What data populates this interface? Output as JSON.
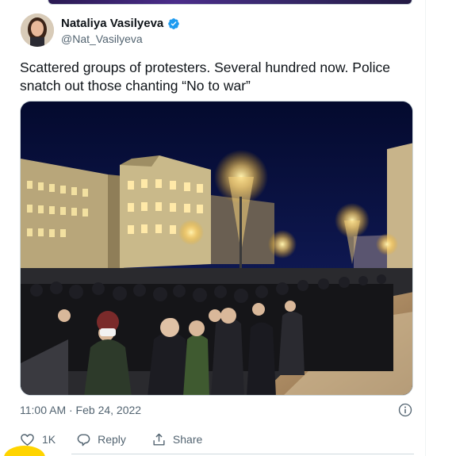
{
  "tweet": {
    "author_name": "Nataliya Vasilyeva",
    "handle": "@Nat_Vasilyeva",
    "verified_icon": "verified-badge-icon",
    "text": "Scattered groups of protesters. Several hundred now. Police snatch out those chanting “No to war”",
    "timestamp": "11:00 AM · Feb 24, 2022",
    "media": {
      "icon": "photo-image"
    }
  },
  "actions": {
    "like_count": "1K",
    "reply_label": "Reply",
    "share_label": "Share"
  },
  "icons": {
    "like": "heart-icon",
    "reply": "speech-bubble-icon",
    "share": "share-icon",
    "info": "info-icon"
  },
  "colors": {
    "primary_text": "#0f1419",
    "secondary_text": "#536471",
    "verified_blue": "#1d9bf0",
    "border": "#cfd9de"
  }
}
